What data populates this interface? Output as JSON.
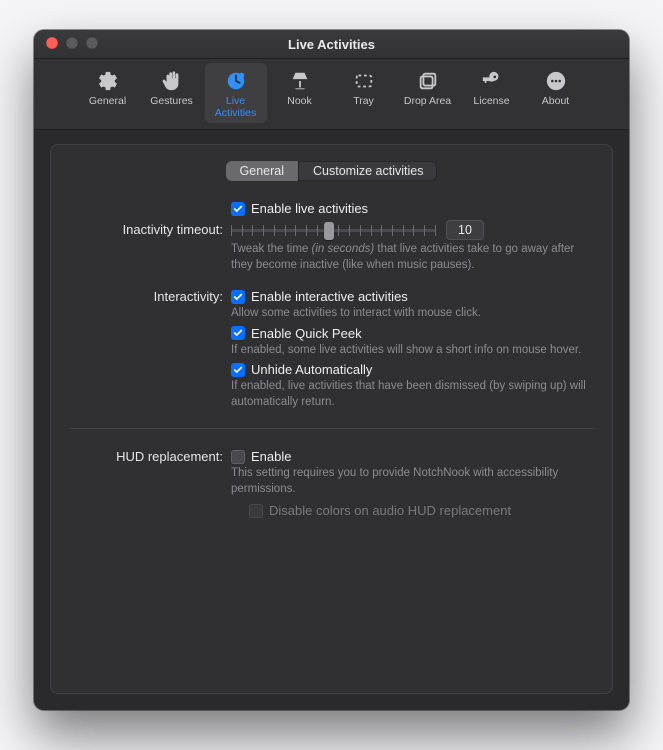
{
  "window": {
    "title": "Live Activities"
  },
  "toolbar": {
    "items": [
      {
        "label": "General",
        "icon": "gear-icon"
      },
      {
        "label": "Gestures",
        "icon": "hand-icon"
      },
      {
        "label": "Live Activities",
        "icon": "clock-activity-icon",
        "selected": true
      },
      {
        "label": "Nook",
        "icon": "lamp-icon"
      },
      {
        "label": "Tray",
        "icon": "rect-dashed-icon"
      },
      {
        "label": "Drop Area",
        "icon": "rect-stack-icon"
      },
      {
        "label": "License",
        "icon": "key-icon"
      },
      {
        "label": "About",
        "icon": "ellipsis-circle-icon"
      }
    ]
  },
  "tabs": {
    "general": "General",
    "customize": "Customize activities",
    "selected": "general"
  },
  "settings": {
    "enable_live_activities": {
      "label": "Enable live activities",
      "checked": true
    },
    "inactivity": {
      "row_label": "Inactivity timeout:",
      "value": "10",
      "value_pct": 48,
      "desc_prefix": "Tweak the time ",
      "desc_em": "(in seconds)",
      "desc_suffix": " that live activities take to go away after they become inactive (like when music pauses)."
    },
    "interactivity": {
      "row_label": "Interactivity:",
      "enable_interactive": {
        "label": "Enable interactive activities",
        "checked": true,
        "desc": "Allow some activities to interact with mouse click."
      },
      "quick_peek": {
        "label": "Enable Quick Peek",
        "checked": true,
        "desc": "If enabled, some live activities will show a short info on mouse hover."
      },
      "unhide_auto": {
        "label": "Unhide Automatically",
        "checked": true,
        "desc": "If enabled, live activities that have been dismissed (by swiping up) will automatically return."
      }
    },
    "hud": {
      "row_label": "HUD replacement:",
      "enable": {
        "label": "Enable",
        "checked": false,
        "desc": "This setting requires you to provide NotchNook with accessibility permissions."
      },
      "disable_colors": {
        "label": "Disable colors on audio HUD replacement",
        "disabled": true
      }
    }
  }
}
